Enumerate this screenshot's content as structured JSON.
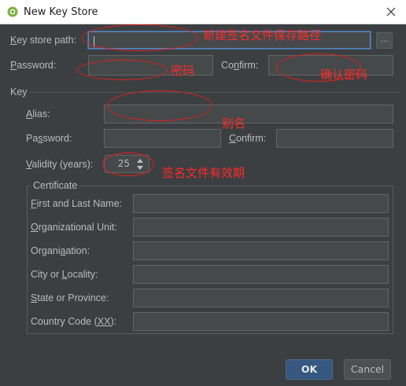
{
  "window": {
    "title": "New Key Store",
    "icon": "android-icon",
    "close_icon": "close-icon"
  },
  "key_store_path": {
    "label": "Key store path:",
    "value": "",
    "browse_label": "..."
  },
  "store_password": {
    "label": "Password:",
    "value": ""
  },
  "store_confirm": {
    "label": "Confirm:",
    "value": ""
  },
  "key_section": {
    "title": "Key",
    "alias": {
      "label": "Alias:",
      "value": ""
    },
    "password": {
      "label": "Password:",
      "value": ""
    },
    "confirm": {
      "label": "Confirm:",
      "value": ""
    },
    "validity": {
      "label": "Validity (years):",
      "value": "25"
    },
    "certificate": {
      "title": "Certificate",
      "fields": [
        {
          "label": "First and Last Name:",
          "value": ""
        },
        {
          "label": "Organizational Unit:",
          "value": ""
        },
        {
          "label": "Organization:",
          "value": ""
        },
        {
          "label": "City or Locality:",
          "value": ""
        },
        {
          "label": "State or Province:",
          "value": ""
        },
        {
          "label": "Country Code (XX):",
          "value": ""
        }
      ]
    }
  },
  "buttons": {
    "ok": "OK",
    "cancel": "Cancel"
  },
  "annotations": {
    "path_note": "新建签名文件保存路径",
    "password_note": "密码",
    "confirm_note": "确认密码",
    "alias_note": "别名",
    "validity_note": "签名文件有效期",
    "color": "#ff2a2a"
  },
  "colors": {
    "background": "#3c3f41",
    "field_bg": "#45494a",
    "accent": "#365880",
    "text": "#bbbbbb"
  }
}
